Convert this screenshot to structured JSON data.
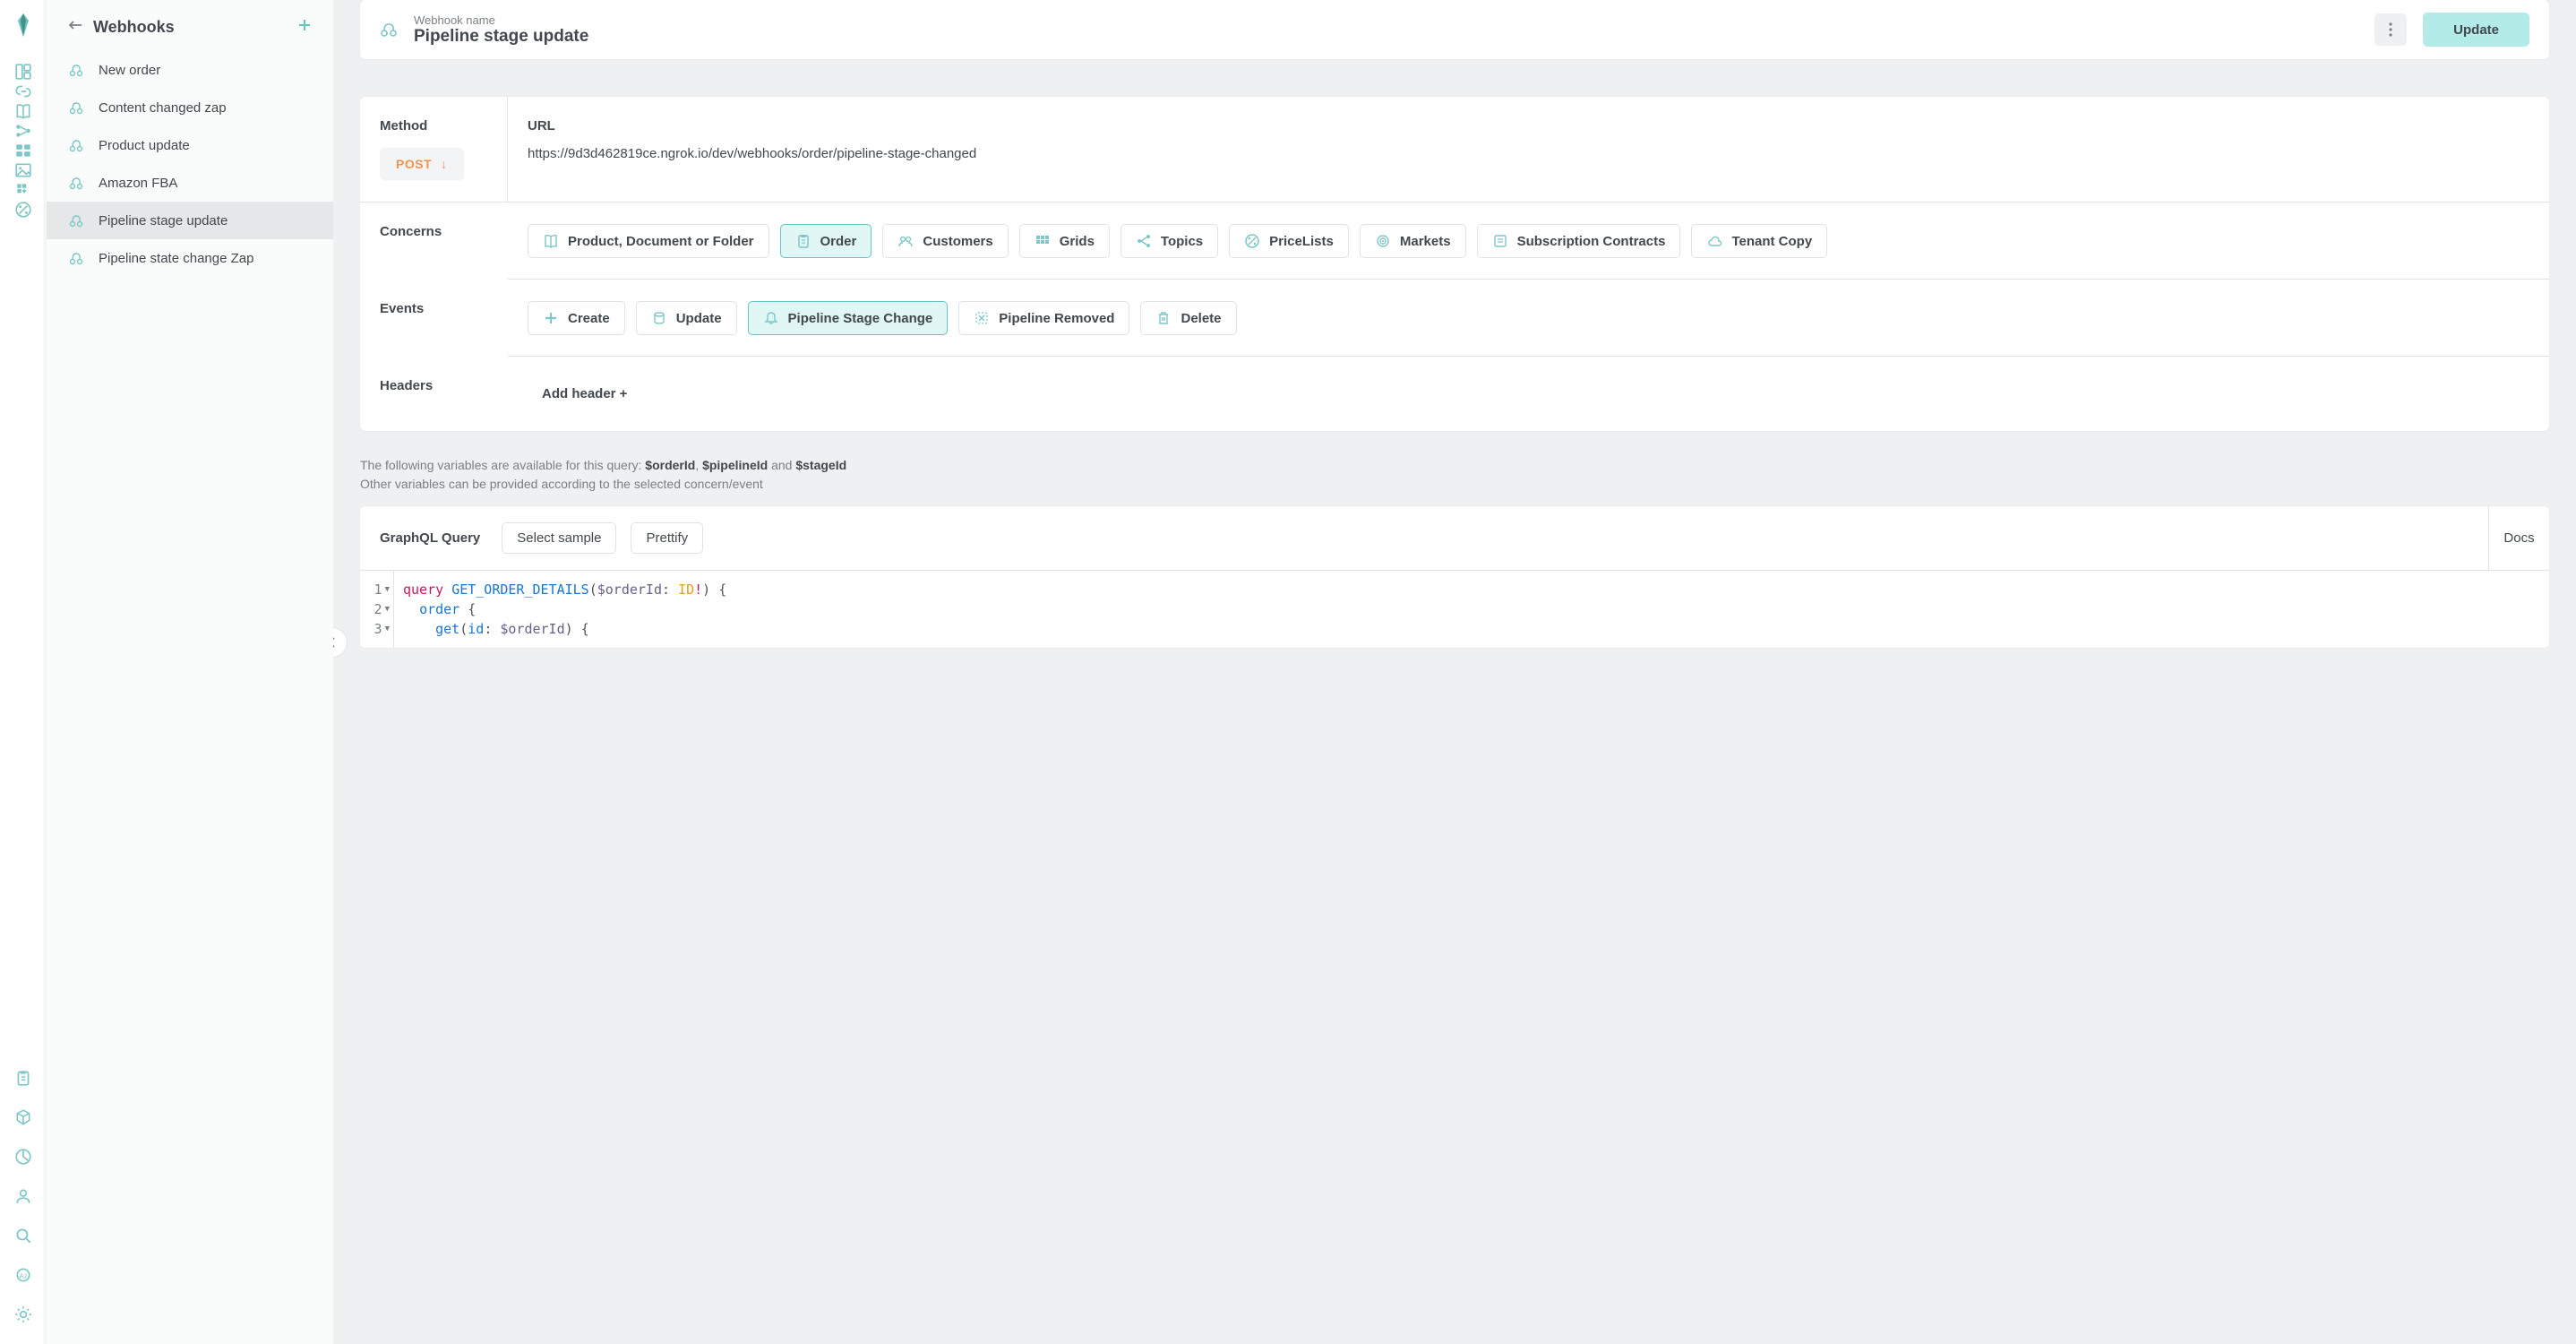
{
  "rail": {
    "icons": [
      {
        "name": "dashboard-icon"
      },
      {
        "name": "link-icon"
      },
      {
        "name": "book-icon"
      },
      {
        "name": "graph-icon"
      },
      {
        "name": "grid-icon"
      },
      {
        "name": "image-icon"
      },
      {
        "name": "blocks-icon"
      },
      {
        "name": "percent-icon"
      }
    ],
    "bottomIcons": [
      {
        "name": "clipboard-icon"
      },
      {
        "name": "cube-icon"
      },
      {
        "name": "pie-icon"
      },
      {
        "name": "user-icon"
      },
      {
        "name": "search-icon"
      },
      {
        "name": "locale-icon"
      },
      {
        "name": "gear-icon"
      }
    ]
  },
  "list": {
    "title": "Webhooks",
    "items": [
      {
        "label": "New order",
        "active": false
      },
      {
        "label": "Content changed zap",
        "active": false
      },
      {
        "label": "Product update",
        "active": false
      },
      {
        "label": "Amazon FBA",
        "active": false
      },
      {
        "label": "Pipeline stage update",
        "active": true
      },
      {
        "label": "Pipeline state change Zap",
        "active": false
      }
    ]
  },
  "header": {
    "nameLabel": "Webhook name",
    "nameValue": "Pipeline stage update",
    "moreLabel": "More",
    "updateLabel": "Update"
  },
  "config": {
    "methodLabel": "Method",
    "methodValue": "POST",
    "urlLabel": "URL",
    "urlValue": "https://9d3d462819ce.ngrok.io/dev/webhooks/order/pipeline-stage-changed",
    "concernsLabel": "Concerns",
    "concerns": [
      {
        "label": "Product, Document or Folder",
        "icon": "book-icon",
        "selected": false
      },
      {
        "label": "Order",
        "icon": "clipboard-icon",
        "selected": true
      },
      {
        "label": "Customers",
        "icon": "users-icon",
        "selected": false
      },
      {
        "label": "Grids",
        "icon": "grids-icon",
        "selected": false
      },
      {
        "label": "Topics",
        "icon": "topics-icon",
        "selected": false
      },
      {
        "label": "PriceLists",
        "icon": "percent-icon",
        "selected": false
      },
      {
        "label": "Markets",
        "icon": "target-icon",
        "selected": false
      },
      {
        "label": "Subscription Contracts",
        "icon": "contract-icon",
        "selected": false
      },
      {
        "label": "Tenant Copy",
        "icon": "cloud-icon",
        "selected": false
      }
    ],
    "eventsLabel": "Events",
    "events": [
      {
        "label": "Create",
        "icon": "plus-icon",
        "selected": false
      },
      {
        "label": "Update",
        "icon": "cylinder-icon",
        "selected": false
      },
      {
        "label": "Pipeline Stage Change",
        "icon": "bell-icon",
        "selected": true
      },
      {
        "label": "Pipeline Removed",
        "icon": "remove-icon",
        "selected": false
      },
      {
        "label": "Delete",
        "icon": "trash-icon",
        "selected": false
      }
    ],
    "headersLabel": "Headers",
    "addHeaderLabel": "Add header +"
  },
  "hint": {
    "prefix": "The following variables are available for this query: ",
    "vars": [
      "$orderId",
      "$pipelineId",
      "$stageId"
    ],
    "and": " and ",
    "sep": ", ",
    "line2": "Other variables can be provided according to the selected concern/event"
  },
  "query": {
    "title": "GraphQL Query",
    "selectSample": "Select sample",
    "prettify": "Prettify",
    "docs": "Docs",
    "lines": [
      {
        "n": 1,
        "fold": true,
        "tokens": [
          [
            "kw",
            "query "
          ],
          [
            "name",
            "GET_ORDER_DETAILS"
          ],
          [
            "punc",
            "("
          ],
          [
            "var",
            "$orderId"
          ],
          [
            "punc",
            ": "
          ],
          [
            "type",
            "ID"
          ],
          [
            "op",
            "!"
          ],
          [
            "punc",
            ")"
          ],
          [
            "punc",
            " {"
          ]
        ]
      },
      {
        "n": 2,
        "fold": true,
        "tokens": [
          [
            "punc",
            "  "
          ],
          [
            "field",
            "order"
          ],
          [
            "punc",
            " {"
          ]
        ]
      },
      {
        "n": 3,
        "fold": true,
        "tokens": [
          [
            "punc",
            "    "
          ],
          [
            "field",
            "get"
          ],
          [
            "punc",
            "("
          ],
          [
            "field",
            "id"
          ],
          [
            "punc",
            ": "
          ],
          [
            "var",
            "$orderId"
          ],
          [
            "punc",
            ")"
          ],
          [
            "punc",
            " {"
          ]
        ]
      }
    ]
  },
  "colors": {
    "accent": "#5fc9c1",
    "accentLight": "#b3ebe9",
    "accentPale": "#e0f7f6",
    "orange": "#f2944d"
  }
}
